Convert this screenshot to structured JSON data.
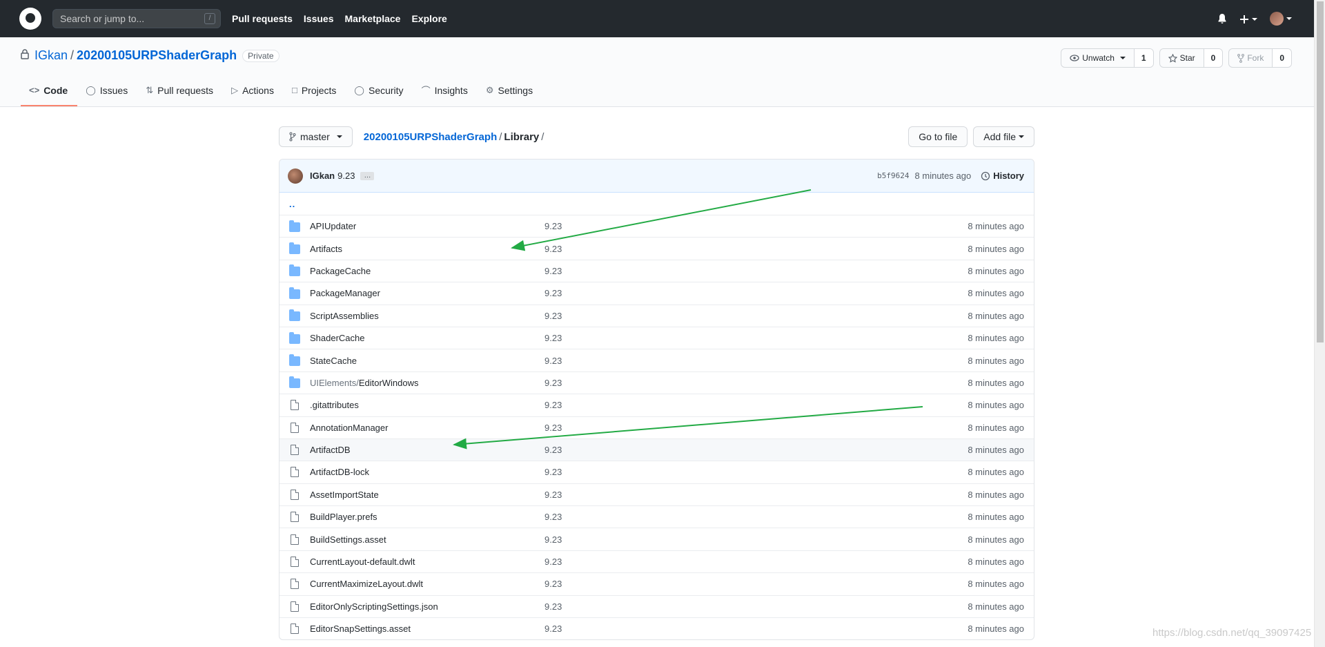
{
  "header": {
    "search_placeholder": "Search or jump to...",
    "search_key": "/",
    "nav": [
      "Pull requests",
      "Issues",
      "Marketplace",
      "Explore"
    ]
  },
  "repo": {
    "owner": "IGkan",
    "name": "20200105URPShaderGraph",
    "visibility": "Private",
    "unwatch_label": "Unwatch",
    "watch_count": "1",
    "star_label": "Star",
    "star_count": "0",
    "fork_label": "Fork",
    "fork_count": "0",
    "tabs": [
      {
        "label": "Code",
        "icon": "code-icon"
      },
      {
        "label": "Issues",
        "icon": "issue-icon"
      },
      {
        "label": "Pull requests",
        "icon": "pull-request-icon"
      },
      {
        "label": "Actions",
        "icon": "play-icon"
      },
      {
        "label": "Projects",
        "icon": "project-icon"
      },
      {
        "label": "Security",
        "icon": "shield-icon"
      },
      {
        "label": "Insights",
        "icon": "graph-icon"
      },
      {
        "label": "Settings",
        "icon": "gear-icon"
      }
    ]
  },
  "browser": {
    "branch": "master",
    "crumb_repo": "20200105URPShaderGraph",
    "crumb_dir": "Library",
    "go_to_file": "Go to file",
    "add_file": "Add file"
  },
  "commit": {
    "author": "IGkan",
    "message": "9.23",
    "ellipsis": "…",
    "sha": "b5f9624",
    "time": "8 minutes ago",
    "history": "History"
  },
  "parent_link": "..",
  "files": [
    {
      "type": "dir",
      "name": "APIUpdater",
      "msg": "9.23",
      "age": "8 minutes ago"
    },
    {
      "type": "dir",
      "name": "Artifacts",
      "msg": "9.23",
      "age": "8 minutes ago"
    },
    {
      "type": "dir",
      "name": "PackageCache",
      "msg": "9.23",
      "age": "8 minutes ago"
    },
    {
      "type": "dir",
      "name": "PackageManager",
      "msg": "9.23",
      "age": "8 minutes ago"
    },
    {
      "type": "dir",
      "name": "ScriptAssemblies",
      "msg": "9.23",
      "age": "8 minutes ago"
    },
    {
      "type": "dir",
      "name": "ShaderCache",
      "msg": "9.23",
      "age": "8 minutes ago"
    },
    {
      "type": "dir",
      "name": "StateCache",
      "msg": "9.23",
      "age": "8 minutes ago"
    },
    {
      "type": "dir",
      "name_prefix": "UIElements/",
      "name": "EditorWindows",
      "msg": "9.23",
      "age": "8 minutes ago"
    },
    {
      "type": "file",
      "name": ".gitattributes",
      "msg": "9.23",
      "age": "8 minutes ago"
    },
    {
      "type": "file",
      "name": "AnnotationManager",
      "msg": "9.23",
      "age": "8 minutes ago"
    },
    {
      "type": "file",
      "name": "ArtifactDB",
      "msg": "9.23",
      "age": "8 minutes ago"
    },
    {
      "type": "file",
      "name": "ArtifactDB-lock",
      "msg": "9.23",
      "age": "8 minutes ago"
    },
    {
      "type": "file",
      "name": "AssetImportState",
      "msg": "9.23",
      "age": "8 minutes ago"
    },
    {
      "type": "file",
      "name": "BuildPlayer.prefs",
      "msg": "9.23",
      "age": "8 minutes ago"
    },
    {
      "type": "file",
      "name": "BuildSettings.asset",
      "msg": "9.23",
      "age": "8 minutes ago"
    },
    {
      "type": "file",
      "name": "CurrentLayout-default.dwlt",
      "msg": "9.23",
      "age": "8 minutes ago"
    },
    {
      "type": "file",
      "name": "CurrentMaximizeLayout.dwlt",
      "msg": "9.23",
      "age": "8 minutes ago"
    },
    {
      "type": "file",
      "name": "EditorOnlyScriptingSettings.json",
      "msg": "9.23",
      "age": "8 minutes ago"
    },
    {
      "type": "file",
      "name": "EditorSnapSettings.asset",
      "msg": "9.23",
      "age": "8 minutes ago"
    }
  ],
  "watermark": "https://blog.csdn.net/qq_39097425",
  "colors": {
    "annotation_arrow": "#22aa44",
    "link": "#0366d6",
    "header_bg": "#24292e"
  }
}
